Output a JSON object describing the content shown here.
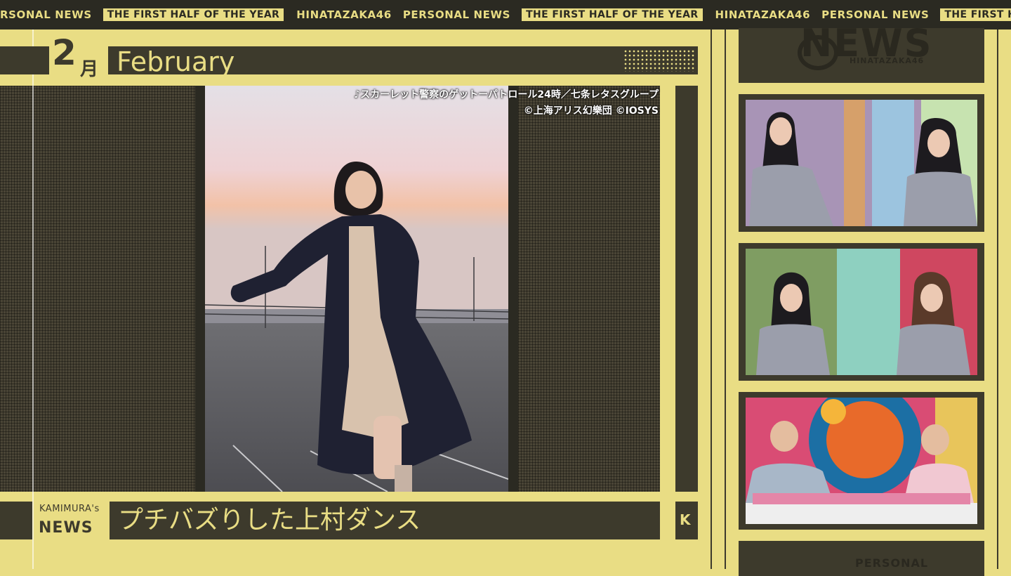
{
  "ticker": [
    {
      "text": "RSONAL NEWS",
      "style": "plain"
    },
    {
      "text": "THE FIRST HALF OF THE YEAR",
      "style": "box"
    },
    {
      "text": "HINATAZAKA46",
      "style": "plain"
    },
    {
      "text": "PERSONAL NEWS",
      "style": "plain"
    },
    {
      "text": "THE FIRST HALF OF THE YEAR",
      "style": "box"
    },
    {
      "text": "HINATAZAKA46",
      "style": "plain"
    },
    {
      "text": "PERSONAL NEWS",
      "style": "plain"
    },
    {
      "text": "THE FIRST HALF OF THE YE",
      "style": "box"
    }
  ],
  "header": {
    "month_number": "2",
    "month_kanji": "月",
    "month_name": "February"
  },
  "photo": {
    "credit_line1": "♪スカーレット警察のゲットーパトロール24時／七条レタスグループ",
    "credit_line2": "©上海アリス幻樂団 ©IOSYS"
  },
  "caption": {
    "logo_top": "KAMIMURA's",
    "logo_bottom": "NEWS",
    "text": "プチバズりした上村ダンス",
    "badge": "K"
  },
  "sidebar": {
    "logo": "NEWS",
    "logo_sub": "HINATAZAKA46",
    "bottom_label": "PERSONAL"
  },
  "colors": {
    "background": "#e9dd84",
    "dark": "#3d3a2c",
    "ticker_bg": "#2b2a22"
  }
}
